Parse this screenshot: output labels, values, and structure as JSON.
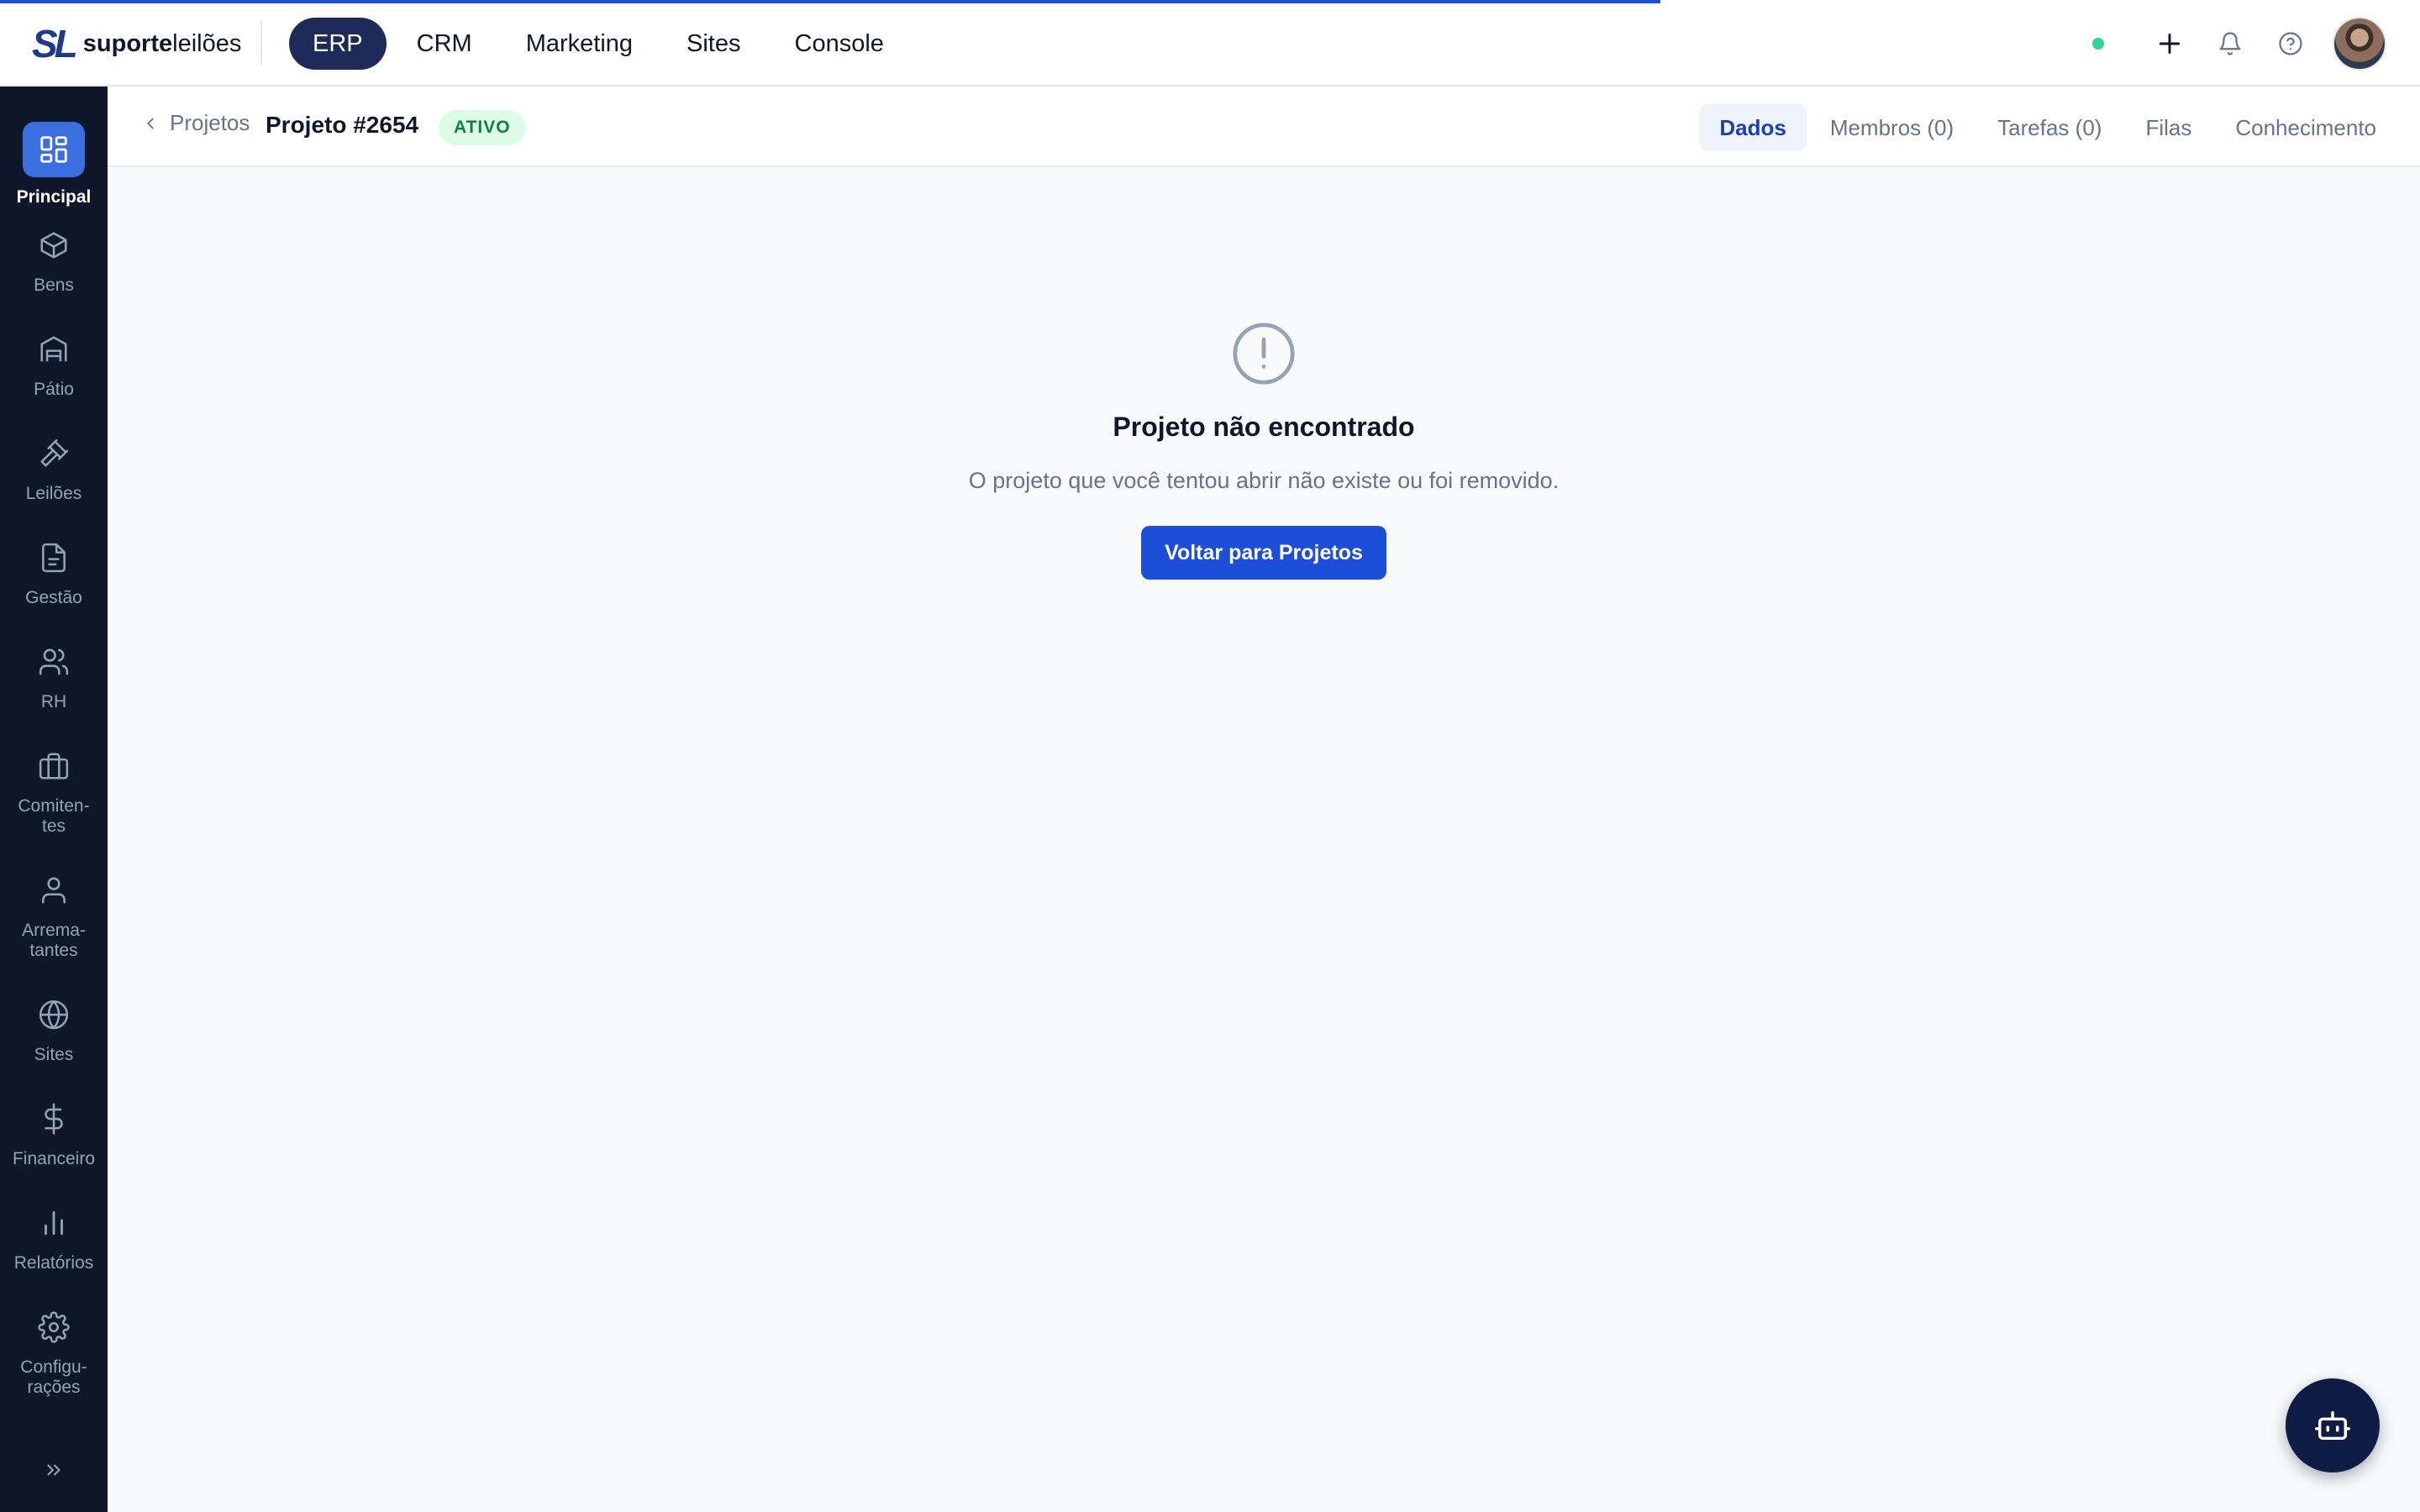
{
  "app": {
    "logo_mark": "SL",
    "logo_text_bold": "suporte",
    "logo_text_light": "leilões"
  },
  "topnav": {
    "items": [
      {
        "label": "ERP",
        "active": true
      },
      {
        "label": "CRM",
        "active": false
      },
      {
        "label": "Marketing",
        "active": false
      },
      {
        "label": "Sites",
        "active": false
      },
      {
        "label": "Console",
        "active": false
      }
    ]
  },
  "topbar_icons": [
    "status-online-dot",
    "plus-icon",
    "bell-icon",
    "help-circle-icon",
    "avatar"
  ],
  "sidebar": {
    "items": [
      {
        "label": "Principal",
        "icon": "dashboard-icon",
        "active": true
      },
      {
        "label": "Bens",
        "icon": "box-icon",
        "active": false
      },
      {
        "label": "Pátio",
        "icon": "warehouse-icon",
        "active": false
      },
      {
        "label": "Leilões",
        "icon": "gavel-icon",
        "active": false
      },
      {
        "label": "Gestão",
        "icon": "document-icon",
        "active": false
      },
      {
        "label": "RH",
        "icon": "users-icon",
        "active": false
      },
      {
        "label": "Comiten-\ntes",
        "icon": "briefcase-icon",
        "active": false
      },
      {
        "label": "Arrema-\ntantes",
        "icon": "user-icon",
        "active": false
      },
      {
        "label": "Sites",
        "icon": "globe-icon",
        "active": false
      },
      {
        "label": "Financeiro",
        "icon": "dollar-icon",
        "active": false
      },
      {
        "label": "Relatórios",
        "icon": "bar-chart-icon",
        "active": false
      },
      {
        "label": "Configu-\nrações",
        "icon": "gear-icon",
        "active": false
      }
    ]
  },
  "header": {
    "back_label": "Projetos",
    "title": "Projeto #2654",
    "status_badge": "ATIVO",
    "tabs": [
      {
        "label": "Dados",
        "active": true
      },
      {
        "label": "Membros (0)",
        "active": false
      },
      {
        "label": "Tarefas (0)",
        "active": false
      },
      {
        "label": "Filas",
        "active": false
      },
      {
        "label": "Conhecimento",
        "active": false
      }
    ]
  },
  "empty_state": {
    "title": "Projeto não encontrado",
    "description": "O projeto que você tentou abrir não existe ou foi removido.",
    "button_label": "Voltar para Projetos"
  },
  "colors": {
    "brand": "#1e3a8a",
    "primary": "#1d4ed8",
    "sidebar_bg": "#0f172a",
    "active_nav": "#1e2a5a",
    "badge_bg": "#dcfce7",
    "badge_text": "#15803d"
  }
}
